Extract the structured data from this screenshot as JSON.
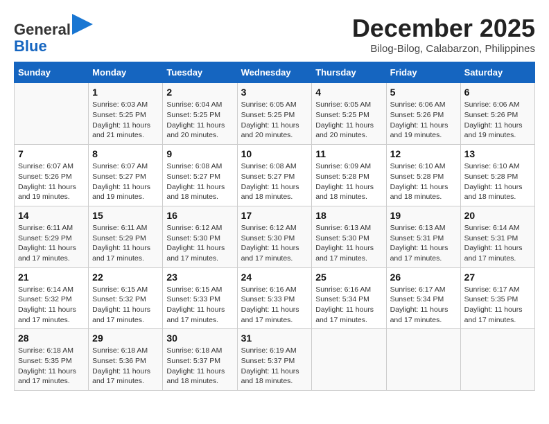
{
  "logo": {
    "general": "General",
    "blue": "Blue"
  },
  "title": "December 2025",
  "location": "Bilog-Bilog, Calabarzon, Philippines",
  "days_header": [
    "Sunday",
    "Monday",
    "Tuesday",
    "Wednesday",
    "Thursday",
    "Friday",
    "Saturday"
  ],
  "weeks": [
    [
      {
        "day": "",
        "info": ""
      },
      {
        "day": "1",
        "info": "Sunrise: 6:03 AM\nSunset: 5:25 PM\nDaylight: 11 hours\nand 21 minutes."
      },
      {
        "day": "2",
        "info": "Sunrise: 6:04 AM\nSunset: 5:25 PM\nDaylight: 11 hours\nand 20 minutes."
      },
      {
        "day": "3",
        "info": "Sunrise: 6:05 AM\nSunset: 5:25 PM\nDaylight: 11 hours\nand 20 minutes."
      },
      {
        "day": "4",
        "info": "Sunrise: 6:05 AM\nSunset: 5:25 PM\nDaylight: 11 hours\nand 20 minutes."
      },
      {
        "day": "5",
        "info": "Sunrise: 6:06 AM\nSunset: 5:26 PM\nDaylight: 11 hours\nand 19 minutes."
      },
      {
        "day": "6",
        "info": "Sunrise: 6:06 AM\nSunset: 5:26 PM\nDaylight: 11 hours\nand 19 minutes."
      }
    ],
    [
      {
        "day": "7",
        "info": "Sunrise: 6:07 AM\nSunset: 5:26 PM\nDaylight: 11 hours\nand 19 minutes."
      },
      {
        "day": "8",
        "info": "Sunrise: 6:07 AM\nSunset: 5:27 PM\nDaylight: 11 hours\nand 19 minutes."
      },
      {
        "day": "9",
        "info": "Sunrise: 6:08 AM\nSunset: 5:27 PM\nDaylight: 11 hours\nand 18 minutes."
      },
      {
        "day": "10",
        "info": "Sunrise: 6:08 AM\nSunset: 5:27 PM\nDaylight: 11 hours\nand 18 minutes."
      },
      {
        "day": "11",
        "info": "Sunrise: 6:09 AM\nSunset: 5:28 PM\nDaylight: 11 hours\nand 18 minutes."
      },
      {
        "day": "12",
        "info": "Sunrise: 6:10 AM\nSunset: 5:28 PM\nDaylight: 11 hours\nand 18 minutes."
      },
      {
        "day": "13",
        "info": "Sunrise: 6:10 AM\nSunset: 5:28 PM\nDaylight: 11 hours\nand 18 minutes."
      }
    ],
    [
      {
        "day": "14",
        "info": "Sunrise: 6:11 AM\nSunset: 5:29 PM\nDaylight: 11 hours\nand 17 minutes."
      },
      {
        "day": "15",
        "info": "Sunrise: 6:11 AM\nSunset: 5:29 PM\nDaylight: 11 hours\nand 17 minutes."
      },
      {
        "day": "16",
        "info": "Sunrise: 6:12 AM\nSunset: 5:30 PM\nDaylight: 11 hours\nand 17 minutes."
      },
      {
        "day": "17",
        "info": "Sunrise: 6:12 AM\nSunset: 5:30 PM\nDaylight: 11 hours\nand 17 minutes."
      },
      {
        "day": "18",
        "info": "Sunrise: 6:13 AM\nSunset: 5:30 PM\nDaylight: 11 hours\nand 17 minutes."
      },
      {
        "day": "19",
        "info": "Sunrise: 6:13 AM\nSunset: 5:31 PM\nDaylight: 11 hours\nand 17 minutes."
      },
      {
        "day": "20",
        "info": "Sunrise: 6:14 AM\nSunset: 5:31 PM\nDaylight: 11 hours\nand 17 minutes."
      }
    ],
    [
      {
        "day": "21",
        "info": "Sunrise: 6:14 AM\nSunset: 5:32 PM\nDaylight: 11 hours\nand 17 minutes."
      },
      {
        "day": "22",
        "info": "Sunrise: 6:15 AM\nSunset: 5:32 PM\nDaylight: 11 hours\nand 17 minutes."
      },
      {
        "day": "23",
        "info": "Sunrise: 6:15 AM\nSunset: 5:33 PM\nDaylight: 11 hours\nand 17 minutes."
      },
      {
        "day": "24",
        "info": "Sunrise: 6:16 AM\nSunset: 5:33 PM\nDaylight: 11 hours\nand 17 minutes."
      },
      {
        "day": "25",
        "info": "Sunrise: 6:16 AM\nSunset: 5:34 PM\nDaylight: 11 hours\nand 17 minutes."
      },
      {
        "day": "26",
        "info": "Sunrise: 6:17 AM\nSunset: 5:34 PM\nDaylight: 11 hours\nand 17 minutes."
      },
      {
        "day": "27",
        "info": "Sunrise: 6:17 AM\nSunset: 5:35 PM\nDaylight: 11 hours\nand 17 minutes."
      }
    ],
    [
      {
        "day": "28",
        "info": "Sunrise: 6:18 AM\nSunset: 5:35 PM\nDaylight: 11 hours\nand 17 minutes."
      },
      {
        "day": "29",
        "info": "Sunrise: 6:18 AM\nSunset: 5:36 PM\nDaylight: 11 hours\nand 17 minutes."
      },
      {
        "day": "30",
        "info": "Sunrise: 6:18 AM\nSunset: 5:37 PM\nDaylight: 11 hours\nand 18 minutes."
      },
      {
        "day": "31",
        "info": "Sunrise: 6:19 AM\nSunset: 5:37 PM\nDaylight: 11 hours\nand 18 minutes."
      },
      {
        "day": "",
        "info": ""
      },
      {
        "day": "",
        "info": ""
      },
      {
        "day": "",
        "info": ""
      }
    ]
  ]
}
